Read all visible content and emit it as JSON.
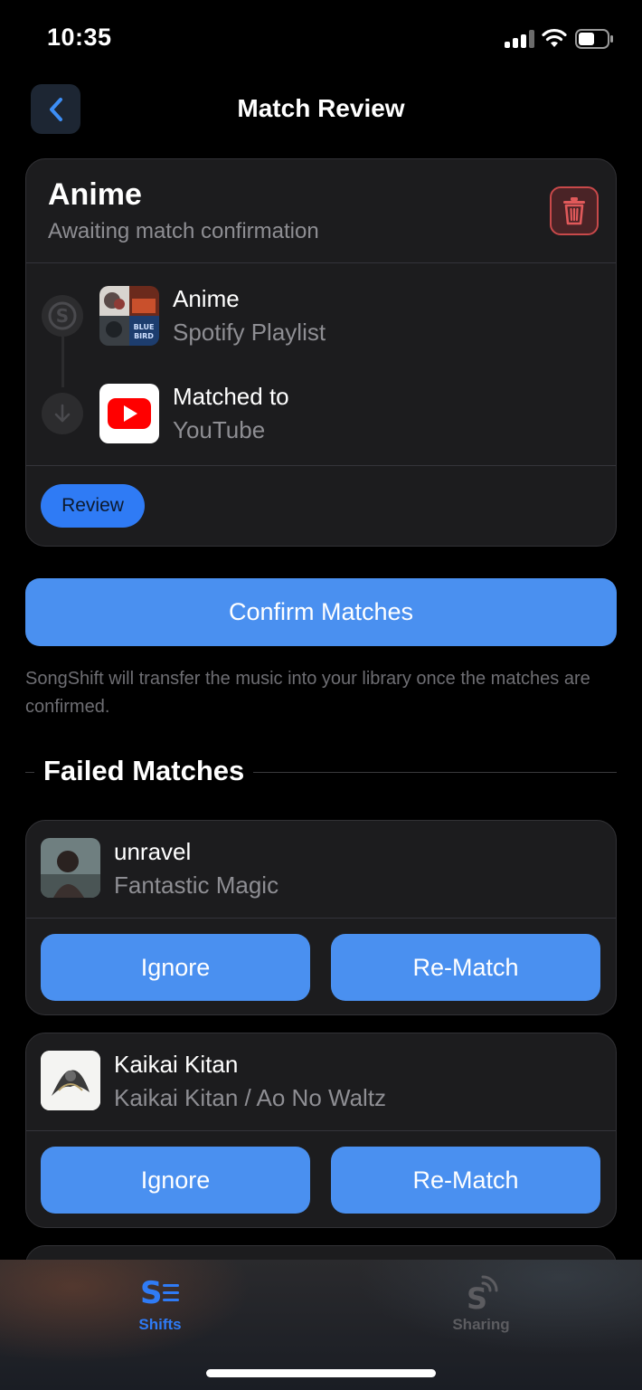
{
  "status_bar": {
    "time": "10:35"
  },
  "header": {
    "title": "Match Review"
  },
  "shift": {
    "title": "Anime",
    "subtitle": "Awaiting match confirmation",
    "source": {
      "name": "Anime",
      "type": "Spotify Playlist"
    },
    "destination": {
      "name": "Matched to",
      "service": "YouTube"
    },
    "status_chip": "Review"
  },
  "confirm_button": "Confirm Matches",
  "footnote": "SongShift will transfer the music into your library once the matches are confirmed.",
  "failed_section": {
    "title": "Failed Matches",
    "items": [
      {
        "title": "unravel",
        "subtitle": "Fantastic Magic",
        "ignore": "Ignore",
        "rematch": "Re-Match"
      },
      {
        "title": "Kaikai Kitan",
        "subtitle": "Kaikai Kitan / Ao No Waltz",
        "ignore": "Ignore",
        "rematch": "Re-Match"
      }
    ]
  },
  "tabs": [
    {
      "label": "Shifts",
      "active": true
    },
    {
      "label": "Sharing",
      "active": false
    }
  ],
  "colors": {
    "accent": "#4a90f0",
    "destructive": "#c8494a",
    "background": "#000000",
    "card": "#1c1c1e"
  }
}
